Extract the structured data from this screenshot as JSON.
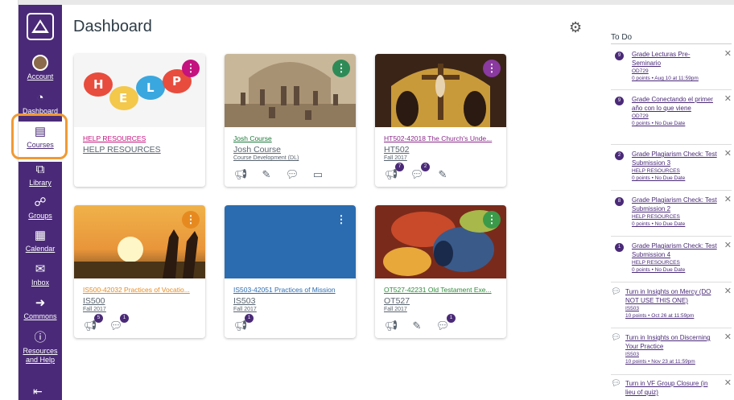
{
  "nav": {
    "account": "Account",
    "dashboard": "Dashboard",
    "courses": "Courses",
    "library": "Library",
    "groups": "Groups",
    "calendar": "Calendar",
    "inbox": "Inbox",
    "commons": "Commons",
    "resources_l1": "Resources",
    "resources_l2": "and Help"
  },
  "page_title": "Dashboard",
  "colors": {
    "nav_bg": "#4a2a78",
    "highlight": "#f19a33"
  },
  "cards": [
    {
      "title": "HELP RESOURCES",
      "code": "HELP RESOURCES",
      "term": "",
      "color": "#c4127f",
      "kebab_color": "#c4127f"
    },
    {
      "title": "Josh Course",
      "code": "Josh Course",
      "term": "Course Development (DL)",
      "color": "#1c7a3a",
      "kebab_color": "#2e8b57"
    },
    {
      "title": "HT502-42018 The Church's Unde...",
      "code": "HT502",
      "term": "Fall 2017",
      "color": "#8a2a8a",
      "kebab_color": "#8a3aa0",
      "badges": {
        "announce": "7",
        "discuss": "2"
      }
    },
    {
      "title": "IS500-42032 Practices of Vocatio...",
      "code": "IS500",
      "term": "Fall 2017",
      "color": "#e68a1f",
      "kebab_color": "#e68a1f",
      "badges": {
        "announce": "5",
        "discuss": "1"
      }
    },
    {
      "title": "IS503-42051 Practices of Mission",
      "code": "IS503",
      "term": "Fall 2017",
      "color": "#2b6cb0",
      "kebab_color": "#2b6cb0",
      "badges": {
        "announce": "1"
      }
    },
    {
      "title": "OT527-42231 Old Testament Exe...",
      "code": "OT527",
      "term": "Fall 2017",
      "color": "#2e8b3a",
      "kebab_color": "#3a9a4a",
      "badges": {
        "discuss": "1"
      }
    }
  ],
  "todo": {
    "heading": "To Do",
    "items": [
      {
        "count": "9",
        "title": "Grade Lecturas Pre-Seminario",
        "course": "OD729",
        "meta": "0 points • Aug 10 at 11:59pm"
      },
      {
        "count": "9",
        "title": "Grade Conectando el primer año con lo que viene",
        "course": "OD729",
        "meta": "0 points • No Due Date"
      },
      {
        "count": "2",
        "title": "Grade Plagiarism Check: Test Submission 3",
        "course": "HELP RESOURCES",
        "meta": "0 points • No Due Date"
      },
      {
        "count": "8",
        "title": "Grade Plagiarism Check: Test Submission 2",
        "course": "HELP RESOURCES",
        "meta": "0 points • No Due Date"
      },
      {
        "count": "1",
        "title": "Grade Plagiarism Check: Test Submission 4",
        "course": "HELP RESOURCES",
        "meta": "0 points • No Due Date"
      },
      {
        "title": "Turn in Insights on Mercy (DO NOT USE THIS ONE)",
        "course": "IS503",
        "meta": "10 points • Oct 26 at 11:59pm"
      },
      {
        "title": "Turn in Insights on Discerning Your Practice",
        "course": "IS503",
        "meta": "10 points • Nov 23 at 11:59pm"
      },
      {
        "title": "Turn in VF Group Closure (in lieu of quiz)",
        "course": "",
        "meta": ""
      }
    ]
  }
}
